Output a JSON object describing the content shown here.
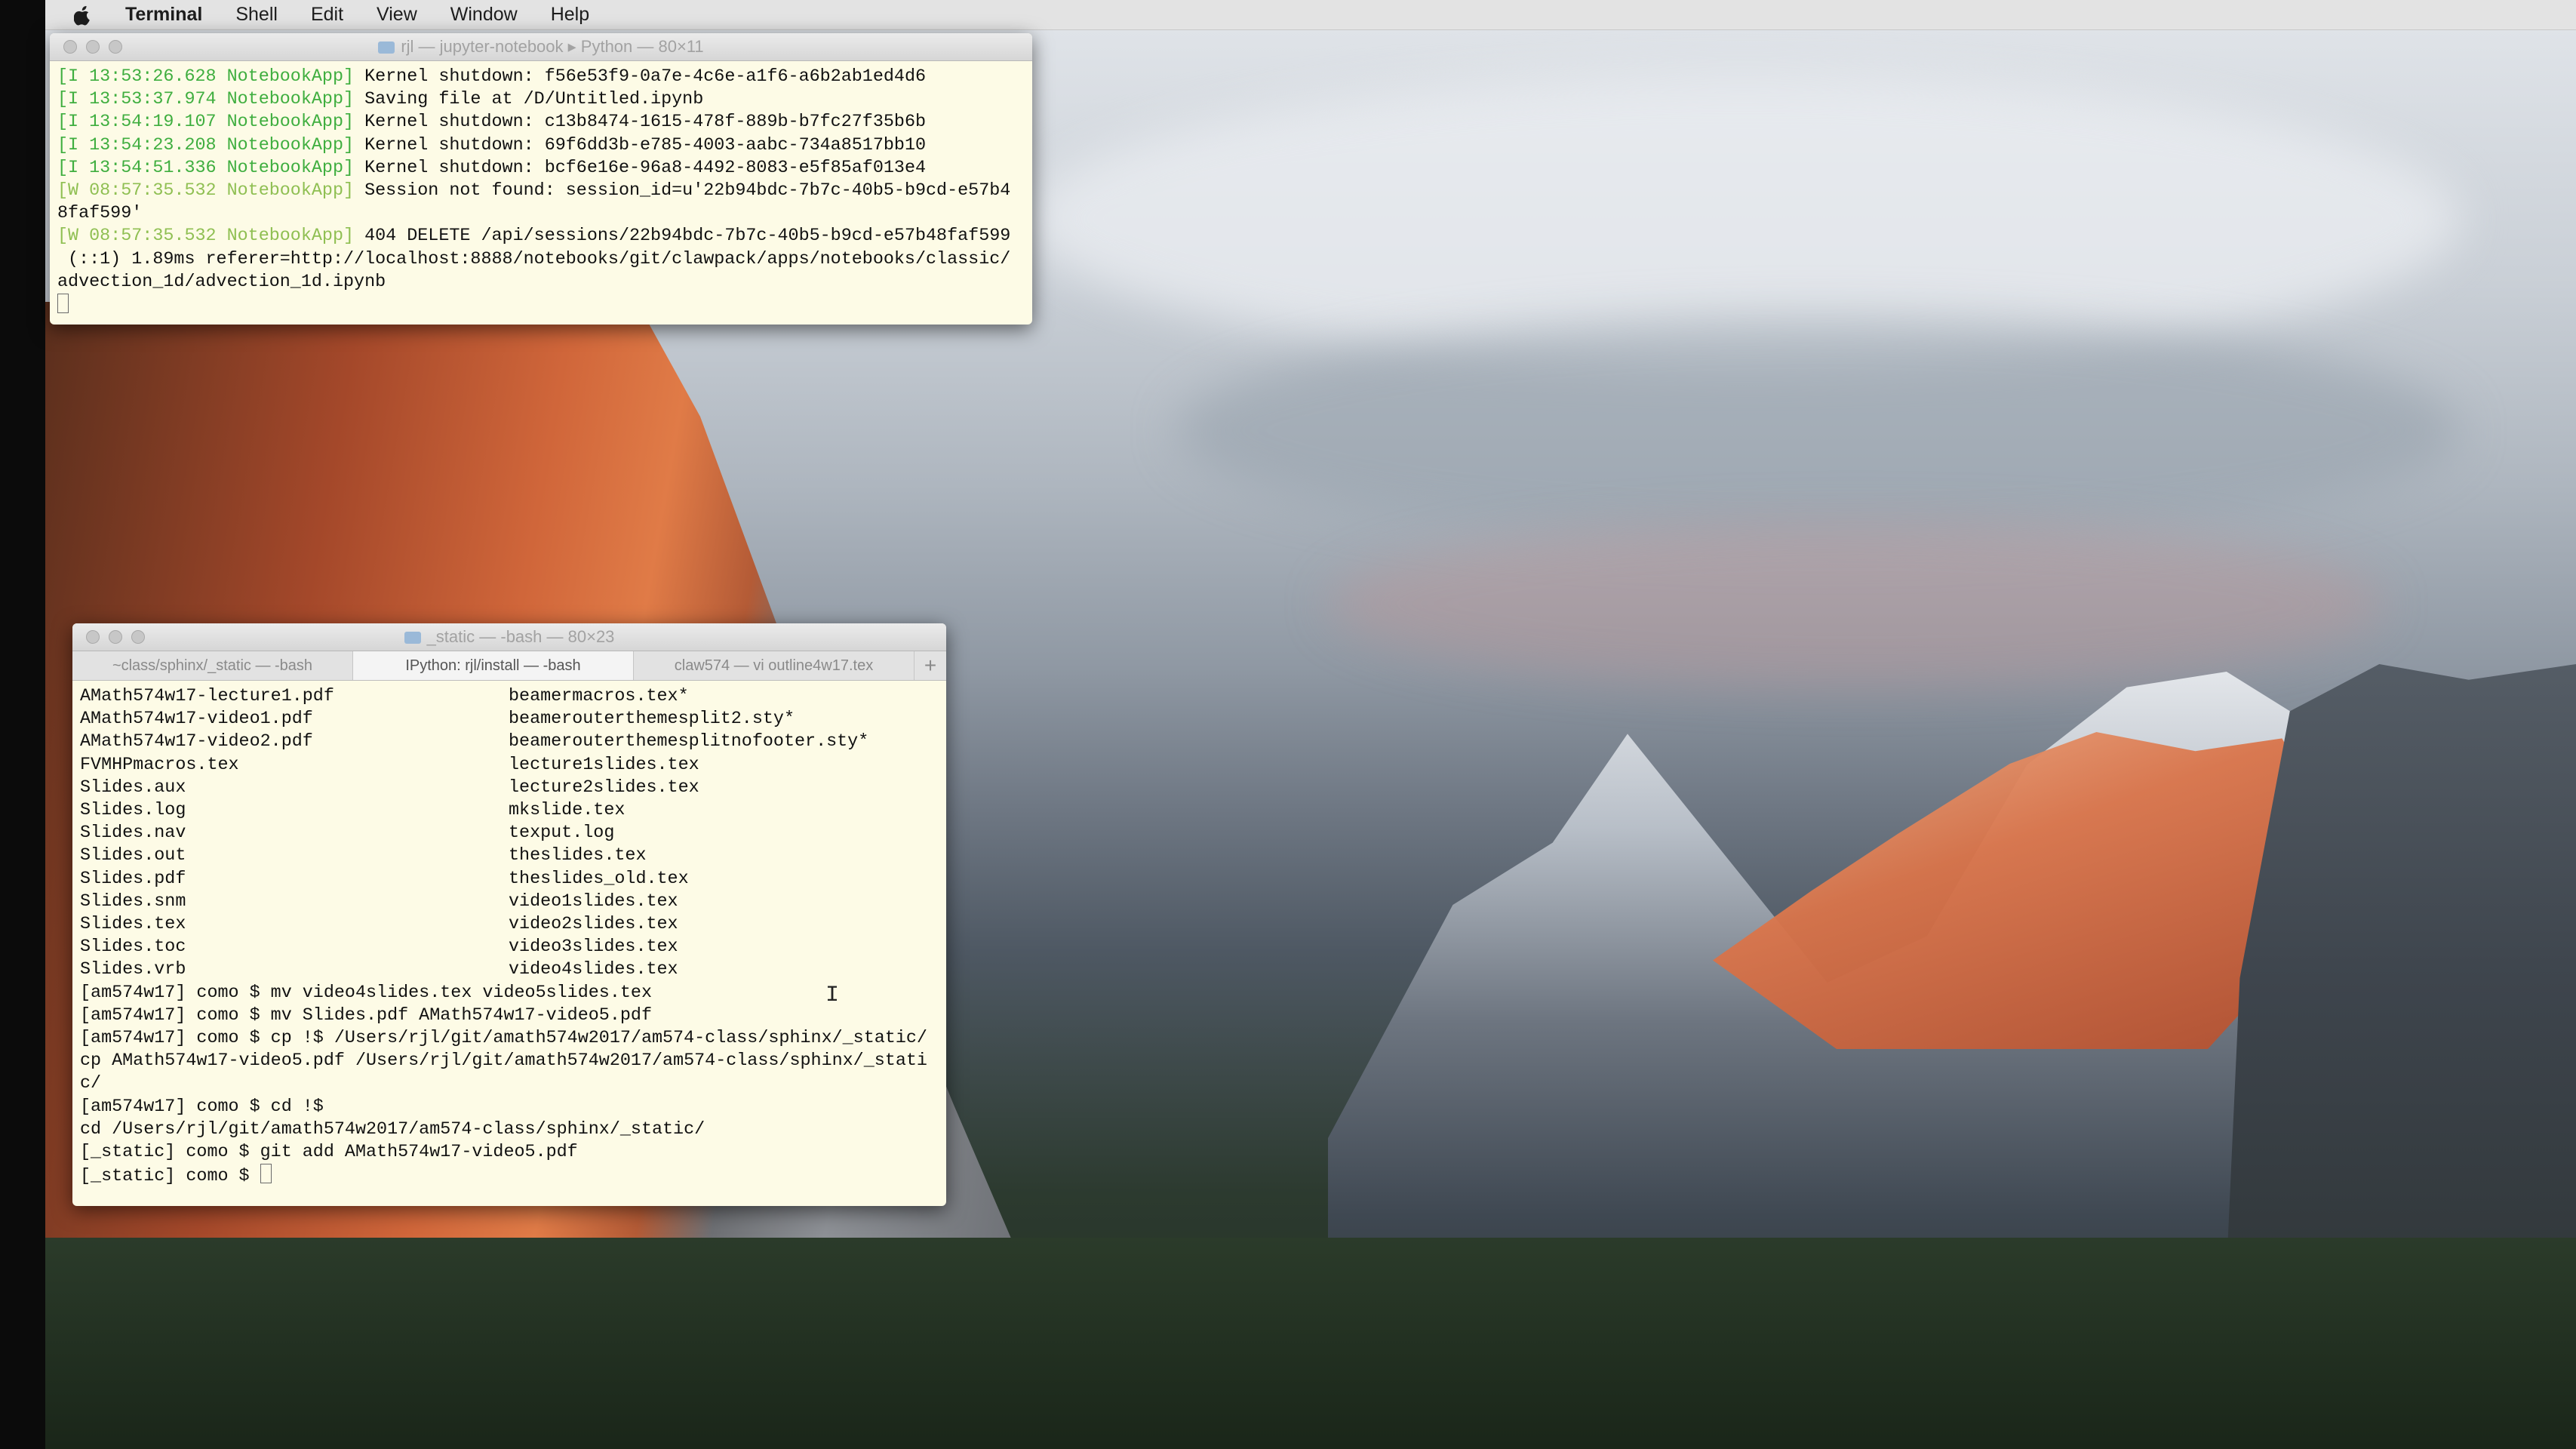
{
  "menubar": {
    "app": "Terminal",
    "items": [
      "Shell",
      "Edit",
      "View",
      "Window",
      "Help"
    ]
  },
  "notebook_window": {
    "title": "rjl — jupyter-notebook ▸ Python — 80×11",
    "lines": [
      {
        "prefix": "[I 13:53:26.628 NotebookApp]",
        "text": " Kernel shutdown: f56e53f9-0a7e-4c6e-a1f6-a6b2ab1ed4d6",
        "kind": "info"
      },
      {
        "prefix": "[I 13:53:37.974 NotebookApp]",
        "text": " Saving file at /D/Untitled.ipynb",
        "kind": "info"
      },
      {
        "prefix": "[I 13:54:19.107 NotebookApp]",
        "text": " Kernel shutdown: c13b8474-1615-478f-889b-b7fc27f35b6b",
        "kind": "info"
      },
      {
        "prefix": "[I 13:54:23.208 NotebookApp]",
        "text": " Kernel shutdown: 69f6dd3b-e785-4003-aabc-734a8517bb10",
        "kind": "info"
      },
      {
        "prefix": "[I 13:54:51.336 NotebookApp]",
        "text": " Kernel shutdown: bcf6e16e-96a8-4492-8083-e5f85af013e4",
        "kind": "info"
      },
      {
        "prefix": "[W 08:57:35.532 NotebookApp]",
        "text": " Session not found: session_id=u'22b94bdc-7b7c-40b5-b9cd-e57b4",
        "kind": "warn"
      },
      {
        "prefix": "",
        "text": "8faf599'",
        "kind": "plain"
      },
      {
        "prefix": "[W 08:57:35.532 NotebookApp]",
        "text": " 404 DELETE /api/sessions/22b94bdc-7b7c-40b5-b9cd-e57b48faf599",
        "kind": "warn"
      },
      {
        "prefix": "",
        "text": " (::1) 1.89ms referer=http://localhost:8888/notebooks/git/clawpack/apps/notebooks/classic/",
        "kind": "plain"
      },
      {
        "prefix": "",
        "text": "advection_1d/advection_1d.ipynb",
        "kind": "plain"
      }
    ]
  },
  "bash_window": {
    "title": "_static — -bash — 80×23",
    "tabs": [
      {
        "label": "~class/sphinx/_static — -bash",
        "active": false
      },
      {
        "label": "IPython: rjl/install — -bash",
        "active": true
      },
      {
        "label": "claw574 — vi outline4w17.tex",
        "active": false
      }
    ],
    "listing": [
      [
        "AMath574w17-lecture1.pdf",
        "beamermacros.tex*"
      ],
      [
        "AMath574w17-video1.pdf",
        "beamerouterthemesplit2.sty*"
      ],
      [
        "AMath574w17-video2.pdf",
        "beamerouterthemesplitnofooter.sty*"
      ],
      [
        "FVMHPmacros.tex",
        "lecture1slides.tex"
      ],
      [
        "Slides.aux",
        "lecture2slides.tex"
      ],
      [
        "Slides.log",
        "mkslide.tex"
      ],
      [
        "Slides.nav",
        "texput.log"
      ],
      [
        "Slides.out",
        "theslides.tex"
      ],
      [
        "Slides.pdf",
        "theslides_old.tex"
      ],
      [
        "Slides.snm",
        "video1slides.tex"
      ],
      [
        "Slides.tex",
        "video2slides.tex"
      ],
      [
        "Slides.toc",
        "video3slides.tex"
      ],
      [
        "Slides.vrb",
        "video4slides.tex"
      ]
    ],
    "commands": [
      "[am574w17] como $ mv video4slides.tex video5slides.tex",
      "[am574w17] como $ mv Slides.pdf AMath574w17-video5.pdf",
      "[am574w17] como $ cp !$ /Users/rjl/git/amath574w2017/am574-class/sphinx/_static/",
      "cp AMath574w17-video5.pdf /Users/rjl/git/amath574w2017/am574-class/sphinx/_stati",
      "c/",
      "[am574w17] como $ cd !$",
      "cd /Users/rjl/git/amath574w2017/am574-class/sphinx/_static/",
      "[_static] como $ git add AMath574w17-video5.pdf",
      "[_static] como $ "
    ]
  },
  "colors": {
    "terminal_bg": "#fdfbe6",
    "timestamp_green": "#3fae3f"
  },
  "icons": [
    "apple-icon",
    "folder-icon",
    "text-cursor-icon"
  ]
}
